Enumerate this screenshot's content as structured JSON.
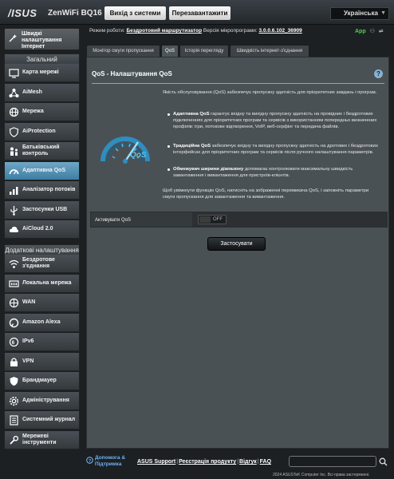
{
  "header": {
    "logo": "/ISUS",
    "model": "ZenWiFi BQ16",
    "logout_label": "Вихід з системи",
    "reboot_label": "Перезавантажити",
    "language": "Українська"
  },
  "status": {
    "prefix": "Режим роботи:",
    "mode": "Бездротовий маршрутизатор",
    "firmware_label": "Версія мікропрограми:",
    "firmware": "3.0.0.6.102_36909",
    "app_label": "App"
  },
  "sidebar": {
    "quick_label": "Швидкі налаштування Інтернет",
    "general_header": "Загальний",
    "general_items": [
      {
        "label": "Карта мережі",
        "icon": "network-map-icon"
      },
      {
        "label": "AiMesh",
        "icon": "aimesh-icon"
      },
      {
        "label": "Мережа",
        "icon": "network-icon"
      },
      {
        "label": "AiProtection",
        "icon": "aiprotection-icon"
      },
      {
        "label": "Батьківський контроль",
        "icon": "parental-control-icon"
      },
      {
        "label": "Адаптивна QoS",
        "icon": "qos-icon"
      },
      {
        "label": "Аналізатор потоків",
        "icon": "traffic-analyzer-icon"
      },
      {
        "label": "Застосунки USB",
        "icon": "usb-icon"
      },
      {
        "label": "AiCloud 2.0",
        "icon": "cloud-icon"
      }
    ],
    "advanced_header": "Додаткові налаштування",
    "advanced_items": [
      {
        "label": "Бездротове з'єднання",
        "icon": "wireless-icon"
      },
      {
        "label": "Локальна мережа",
        "icon": "lan-icon"
      },
      {
        "label": "WAN",
        "icon": "wan-icon"
      },
      {
        "label": "Amazon Alexa",
        "icon": "alexa-icon"
      },
      {
        "label": "IPv6",
        "icon": "ipv6-icon"
      },
      {
        "label": "VPN",
        "icon": "vpn-icon"
      },
      {
        "label": "Брандмауер",
        "icon": "firewall-icon"
      },
      {
        "label": "Адміністрування",
        "icon": "administration-icon"
      },
      {
        "label": "Системний журнал",
        "icon": "system-log-icon"
      },
      {
        "label": "Мережеві інструменти",
        "icon": "network-tools-icon"
      }
    ]
  },
  "tabs": [
    {
      "label": "Монітор смуги пропускання",
      "active": false
    },
    {
      "label": "QoS",
      "active": true
    },
    {
      "label": "Історія перегляду",
      "active": false
    },
    {
      "label": "Швидкість інтернет-з'єднання",
      "active": false
    }
  ],
  "main": {
    "title": "QoS - Налаштування QoS",
    "intro": "Якість обслуговування (QoS) забезпечує пропускну здатність для пріоритетних завдань і програм.",
    "bullets": [
      {
        "bold": "Адаптивна QoS",
        "text": " гарантує вхідну та вихідну пропускну здатність на провідних і бездротових підключеннях для пріоритетних програм та сервісів з використанням попередньо визначених профілів: ігри, потокове відтворення, VoIP, веб-серфінг та передача файлів."
      },
      {
        "bold": "Традиційна QoS",
        "text": " забезпечує вхідну та вихідну пропускну здатність на дротових і бездротових інтерфейсах для пріоритетних програм та сервісів після ручного налаштування параметрів."
      },
      {
        "bold": "Обмежувач ширини діапазону",
        "text": " допомагає контролювати максимальну швидкість завантаження і вивантаження для пристроїв-клієнтів."
      }
    ],
    "outro": "Щоб увімкнути функцію QoS, натисніть на зображенні перемикача QoS, і заповніть параметри смуги пропускання для завантаження та вивантаження.",
    "enable_label": "Активувати QoS",
    "toggle_text": "OFF",
    "apply_label": "Застосувати",
    "gauge_text": "QoS"
  },
  "footer": {
    "help_label": "Допомога & Підтримка",
    "links": [
      "ASUS Support",
      "Реєстрація продукту",
      "Відгук",
      "FAQ"
    ],
    "copyright": "2024 ASUSTeK Computer Inc. Всі права застережені."
  },
  "colors": {
    "accent": "#3e7ea4",
    "link": "#6fb2f0",
    "app_green": "#4fd14f"
  }
}
